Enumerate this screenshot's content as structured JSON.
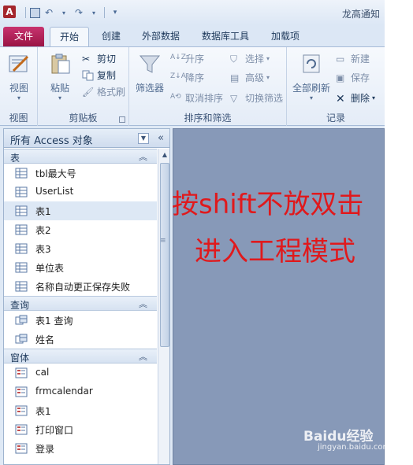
{
  "window": {
    "title": "龙高通知"
  },
  "app_icon_letter": "A",
  "tabs": [
    "文件",
    "开始",
    "创建",
    "外部数据",
    "数据库工具",
    "加载项"
  ],
  "ribbon": {
    "groups": {
      "view": {
        "label": "视图",
        "view_button": "视图"
      },
      "clipboard": {
        "label": "剪贴板",
        "paste": "粘贴",
        "cut": "剪切",
        "copy": "复制",
        "format_painter": "格式刷"
      },
      "sort_filter": {
        "label": "排序和筛选",
        "filter": "筛选器",
        "ascending": "升序",
        "descending": "降序",
        "remove_sort": "取消排序",
        "selection": "选择",
        "advanced": "高级",
        "toggle_filter": "切换筛选"
      },
      "records": {
        "label": "记录",
        "refresh_all": "全部刷新",
        "new": "新建",
        "save": "保存",
        "delete": "删除"
      }
    }
  },
  "nav_pane": {
    "title": "所有 Access 对象",
    "categories": [
      {
        "name": "表",
        "items": [
          "tbl最大号",
          "UserList",
          "表1",
          "表2",
          "表3",
          "单位表",
          "名称自动更正保存失败"
        ]
      },
      {
        "name": "查询",
        "items": [
          "表1 查询",
          "姓名"
        ]
      },
      {
        "name": "窗体",
        "items": [
          "cal",
          "frmcalendar",
          "表1",
          "打印窗口",
          "登录"
        ]
      }
    ],
    "selected_item": "表1"
  },
  "annotation": {
    "line1": "按shift不放双击",
    "line2": "进入工程模式"
  },
  "watermark": {
    "brand": "Baidu经验",
    "url": "jingyan.baidu.com"
  },
  "colors": {
    "file_tab": "#b11c54",
    "workspace": "#8799b8",
    "annotation": "#e0191c"
  }
}
